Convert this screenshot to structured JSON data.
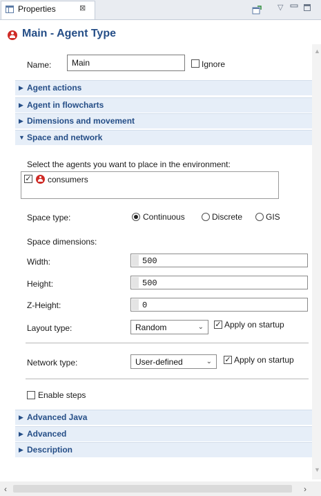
{
  "view": {
    "tab_label": "Properties",
    "tab_close": "⊠",
    "view_menu": "▽"
  },
  "title": "Main - Agent Type",
  "name_row": {
    "label": "Name:",
    "value": "Main",
    "ignore_label": "Ignore",
    "ignore_checked": false
  },
  "sections_top": [
    {
      "label": "Agent actions",
      "arrow": "▶"
    },
    {
      "label": "Agent in flowcharts",
      "arrow": "▶"
    },
    {
      "label": "Dimensions and movement",
      "arrow": "▶"
    },
    {
      "label": "Space and network",
      "arrow": "▼"
    }
  ],
  "space_network": {
    "agents_prompt": "Select the agents you want to place in the environment:",
    "agents": [
      {
        "name": "consumers",
        "checked": true
      }
    ],
    "space_type_label": "Space type:",
    "space_types": [
      {
        "label": "Continuous",
        "selected": true
      },
      {
        "label": "Discrete",
        "selected": false
      },
      {
        "label": "GIS",
        "selected": false
      }
    ],
    "dimensions_label": "Space dimensions:",
    "width": {
      "label": "Width:",
      "value": "500"
    },
    "height": {
      "label": "Height:",
      "value": "500"
    },
    "zheight": {
      "label": "Z-Height:",
      "value": "0"
    },
    "layout": {
      "label": "Layout type:",
      "value": "Random",
      "apply_label": "Apply on startup",
      "apply_checked": true
    },
    "network": {
      "label": "Network type:",
      "value": "User-defined",
      "apply_label": "Apply on startup",
      "apply_checked": true
    },
    "enable_steps": {
      "label": "Enable steps",
      "checked": false
    }
  },
  "sections_bottom": [
    {
      "label": "Advanced Java",
      "arrow": "▶"
    },
    {
      "label": "Advanced",
      "arrow": "▶"
    },
    {
      "label": "Description",
      "arrow": "▶"
    }
  ],
  "glyphs": {
    "check": "✓",
    "dropdown": "⌄",
    "scroll_up": "▲",
    "scroll_down": "▼",
    "scroll_left": "‹",
    "scroll_right": "›"
  },
  "colors": {
    "section_text": "#254e87",
    "section_bg": "#e6eef8",
    "agent_icon": "#cf2b26"
  }
}
